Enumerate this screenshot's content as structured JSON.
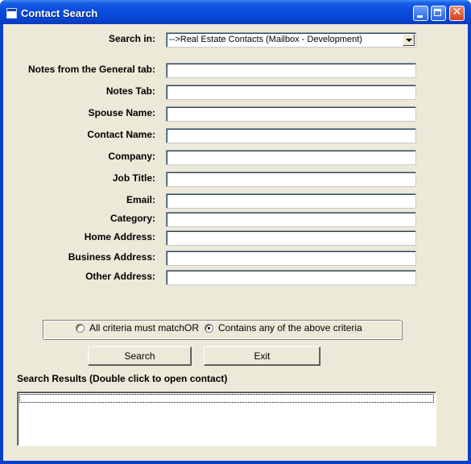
{
  "window": {
    "title": "Contact Search"
  },
  "titlebar": {
    "app_icon": "app-window-icon",
    "minimize": "minimize-icon",
    "maximize": "maximize-icon",
    "close": "close-icon"
  },
  "search_in": {
    "label": "Search in:",
    "value": "-->Real Estate Contacts (Mailbox - Development)"
  },
  "fields": [
    {
      "label": "Notes from the General tab:",
      "value": ""
    },
    {
      "label": "Notes Tab:",
      "value": ""
    },
    {
      "label": "Spouse Name:",
      "value": ""
    },
    {
      "label": "Contact Name:",
      "value": ""
    },
    {
      "label": "Company:",
      "value": ""
    },
    {
      "label": "Job Title:",
      "value": ""
    },
    {
      "label": "Email:",
      "value": ""
    },
    {
      "label": "Category:",
      "value": ""
    },
    {
      "label": "Home Address:",
      "value": ""
    },
    {
      "label": "Business Address:",
      "value": ""
    },
    {
      "label": "Other Address:",
      "value": ""
    }
  ],
  "match_options": {
    "all": {
      "label": "All criteria must match",
      "checked": false
    },
    "or_label": "OR",
    "any": {
      "label": "Contains any of the above criteria",
      "checked": true
    }
  },
  "buttons": {
    "search": "Search",
    "exit": "Exit"
  },
  "results": {
    "label": "Search Results (Double click to open  contact)",
    "items": []
  },
  "colors": {
    "titlebar": "#0a4fd8",
    "client_bg": "#ece9d8"
  }
}
